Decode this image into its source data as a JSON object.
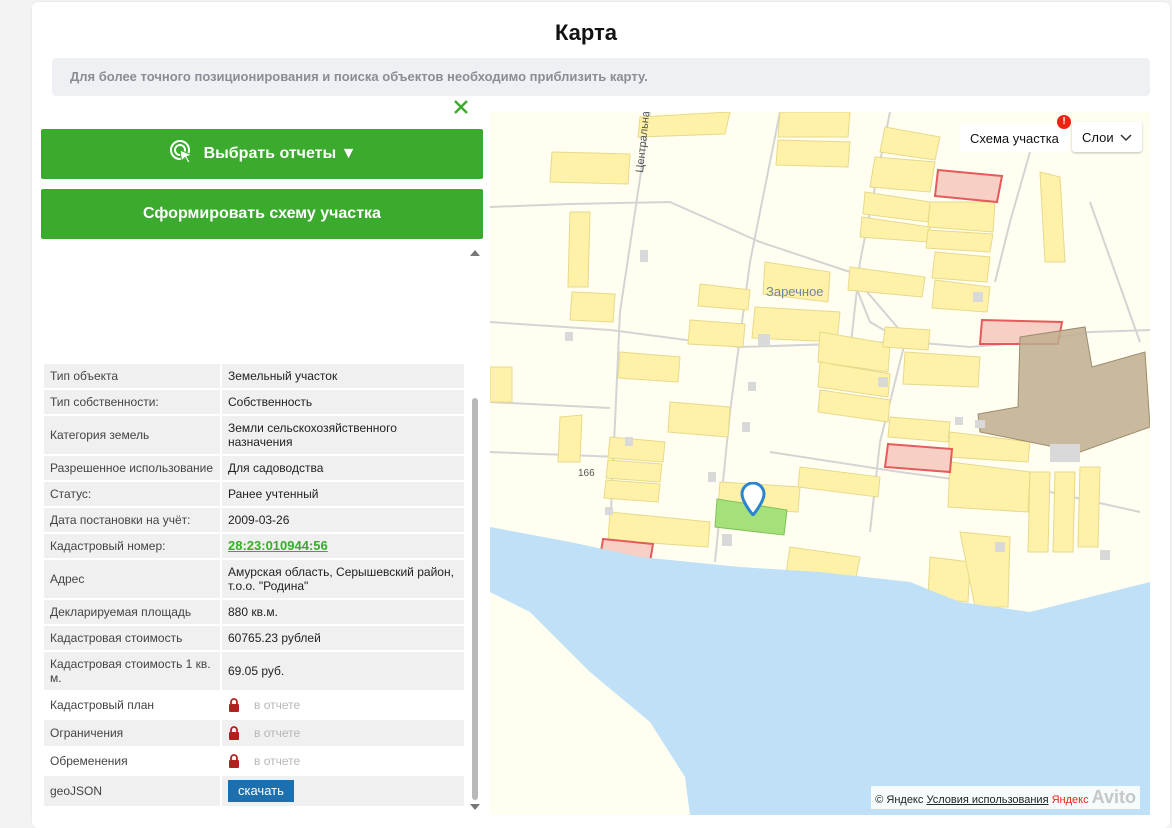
{
  "page": {
    "title": "Карта"
  },
  "notice": "Для более точного позиционирования и поиска объектов необходимо приблизить карту.",
  "buttons": {
    "select_reports": "Выбрать отчеты ▼",
    "form_scheme": "Сформировать схему участка"
  },
  "info_rows": [
    {
      "label": "Тип объекта",
      "value": "Земельный участок"
    },
    {
      "label": "Тип собственности:",
      "value": "Собственность"
    },
    {
      "label": "Категория земель",
      "value": "Земли сельскохозяйственного назначения"
    },
    {
      "label": "Разрешенное использование",
      "value": "Для садоводства"
    },
    {
      "label": "Статус:",
      "value": "Ранее учтенный"
    },
    {
      "label": "Дата постановки на учёт:",
      "value": "2009-03-26"
    },
    {
      "label": "Кадастровый номер:",
      "value": "28:23:010944:56"
    },
    {
      "label": "Адрес",
      "value": "Амурская область, Серышевский район, т.о.о. \"Родина\""
    },
    {
      "label": "Декларируемая площадь",
      "value": "880 кв.м."
    },
    {
      "label": "Кадастровая стоимость",
      "value": "60765.23 рублей"
    },
    {
      "label": "Кадастровая стоимость 1 кв. м.",
      "value": "69.05 руб."
    },
    {
      "label": "Кадастровый план",
      "value": "в отчете"
    },
    {
      "label": "Ограничения",
      "value": "в отчете"
    },
    {
      "label": "Обременения",
      "value": "в отчете"
    },
    {
      "label": "geoJSON",
      "value": "скачать"
    }
  ],
  "map": {
    "scheme_button": "Схема участка",
    "badge": "!",
    "layers_button": "Слои",
    "labels": {
      "street": "Центральная ул.",
      "village": "Заречное",
      "road_number": "166"
    },
    "copyright_prefix": "© Яндекс",
    "terms_link": "Условия использования",
    "brand": "Яндекс",
    "watermark": "Avito",
    "colors": {
      "land": "#fffef0",
      "parcel": "#fff2a8",
      "water": "#bfe0f6",
      "selected": "#a6e07a",
      "restricted": "#e55a5a",
      "forest": "#bfae90"
    }
  },
  "colors": {
    "accent": "#3aab2c",
    "download": "#1d6fae"
  }
}
